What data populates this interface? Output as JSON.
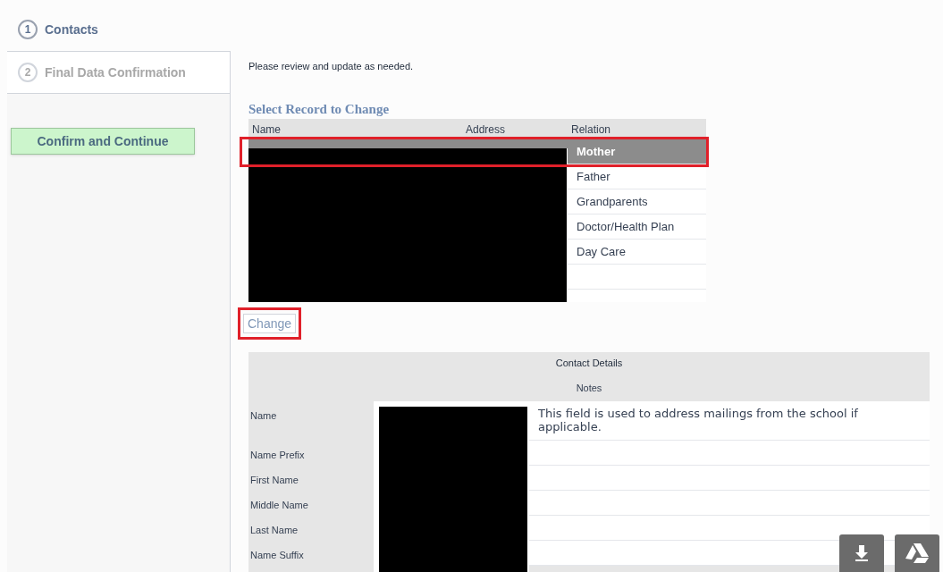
{
  "steps": [
    {
      "number": "1",
      "label": "Contacts",
      "selected": true
    },
    {
      "number": "2",
      "label": "Final Data Confirmation",
      "selected": false
    }
  ],
  "confirm_button": "Confirm and Continue",
  "instructions": "Please review and update as needed.",
  "records": {
    "title": "Select Record to Change",
    "columns": [
      "Name",
      "Address",
      "Relation"
    ],
    "rows": [
      {
        "relation": "Mother",
        "selected": true,
        "highlighted": true
      },
      {
        "relation": "Father",
        "selected": false,
        "highlighted": false
      },
      {
        "relation": "Grandparents",
        "selected": false,
        "highlighted": false
      },
      {
        "relation": "Doctor/Health Plan",
        "selected": false,
        "highlighted": false
      },
      {
        "relation": "Day Care",
        "selected": false,
        "highlighted": false
      },
      {
        "relation": "",
        "selected": false,
        "highlighted": false
      }
    ]
  },
  "change_button": {
    "label": "Change",
    "highlighted": true
  },
  "contact_details": {
    "title": "Contact Details",
    "notes_heading": "Notes",
    "fields": [
      {
        "label": "Name",
        "note": "This field is used to address mailings from the school if applicable."
      },
      {
        "label": "Name Prefix"
      },
      {
        "label": "First Name"
      },
      {
        "label": "Middle Name"
      },
      {
        "label": "Last Name"
      },
      {
        "label": "Name Suffix"
      }
    ]
  },
  "floating_buttons": [
    {
      "kind": "download"
    },
    {
      "kind": "drive"
    }
  ]
}
